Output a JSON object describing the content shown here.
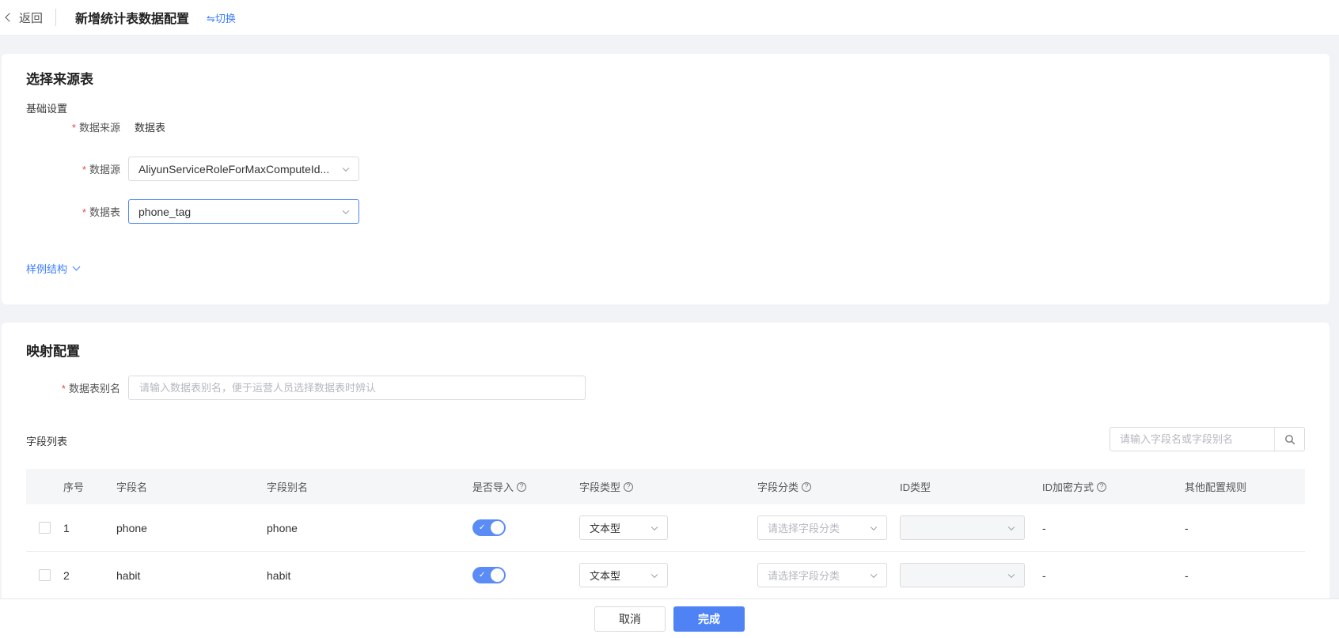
{
  "header": {
    "back_label": "返回",
    "title": "新增统计表数据配置",
    "switch_label": "⇋切换"
  },
  "source": {
    "section_title": "选择来源表",
    "basic_settings": "基础设置",
    "data_origin_label": "数据来源",
    "data_origin_value": "数据表",
    "datasource_label": "数据源",
    "datasource_value": "AliyunServiceRoleForMaxComputeId...",
    "datatable_label": "数据表",
    "datatable_value": "phone_tag",
    "sample_link": "样例结构"
  },
  "mapping": {
    "section_title": "映射配置",
    "alias_label": "数据表别名",
    "alias_placeholder": "请输入数据表别名，便于运营人员选择数据表时辨认",
    "field_list_title": "字段列表",
    "search_placeholder": "请输入字段名或字段别名"
  },
  "table": {
    "headers": {
      "no": "序号",
      "name": "字段名",
      "alias": "字段别名",
      "import": "是否导入",
      "type": "字段类型",
      "category": "字段分类",
      "id_type": "ID类型",
      "encryption": "ID加密方式",
      "rules": "其他配置规则"
    },
    "rows": [
      {
        "no": "1",
        "name": "phone",
        "alias": "phone",
        "import_on": true,
        "type": "文本型",
        "category_placeholder": "请选择字段分类",
        "encryption": "-",
        "rules": "-"
      },
      {
        "no": "2",
        "name": "habit",
        "alias": "habit",
        "import_on": true,
        "type": "文本型",
        "category_placeholder": "请选择字段分类",
        "encryption": "-",
        "rules": "-"
      }
    ]
  },
  "footer": {
    "cancel_label": "取消",
    "ok_label": "完成"
  },
  "colors": {
    "accent": "#4f83f5",
    "required": "#e5484d",
    "link": "#3b7cff"
  }
}
